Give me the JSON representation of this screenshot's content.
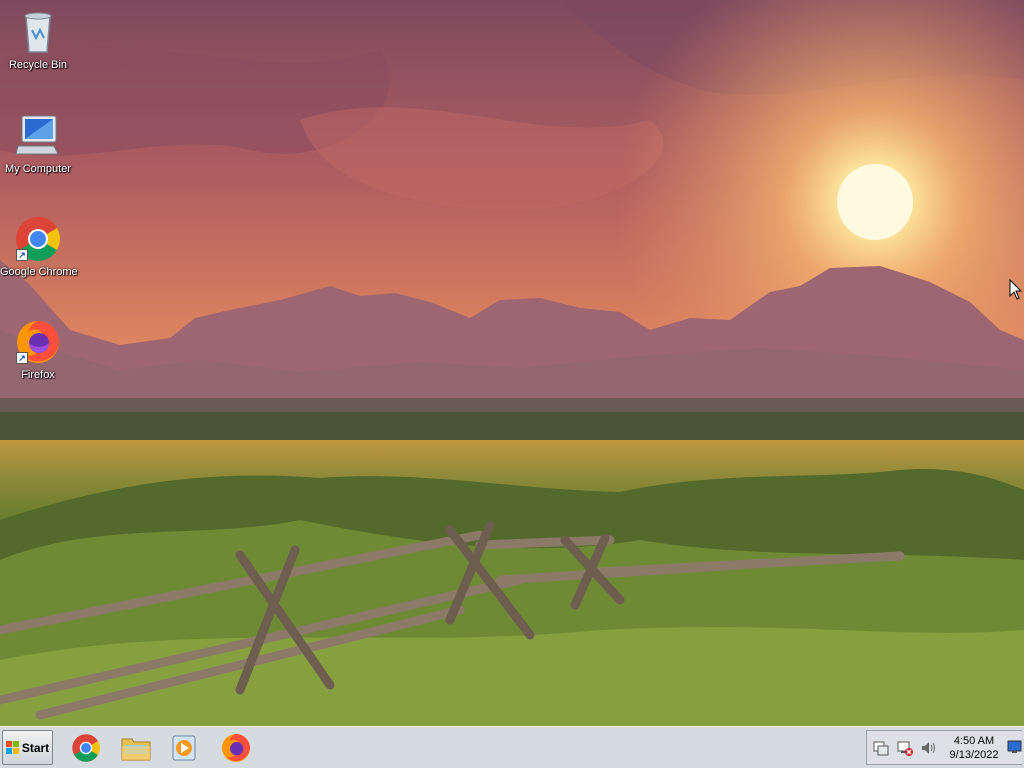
{
  "desktop": {
    "icons": [
      {
        "label": "Recycle Bin",
        "icon": "recycle-bin-icon"
      },
      {
        "label": "My Computer",
        "icon": "computer-icon"
      },
      {
        "label": "Google Chrome",
        "icon": "chrome-icon"
      },
      {
        "label": "Firefox",
        "icon": "firefox-icon"
      }
    ]
  },
  "taskbar": {
    "start_label": "Start",
    "pinned": [
      {
        "icon": "chrome-icon"
      },
      {
        "icon": "file-explorer-icon"
      },
      {
        "icon": "media-player-icon"
      },
      {
        "icon": "firefox-icon"
      }
    ],
    "tray": {
      "icons": [
        "action-center-icon",
        "network-disconnected-icon",
        "volume-icon"
      ],
      "time": "4:50 AM",
      "date": "9/13/2022"
    }
  },
  "colors": {
    "taskbar_bg": "#d6dbe0",
    "icon_label": "#ffffff"
  }
}
